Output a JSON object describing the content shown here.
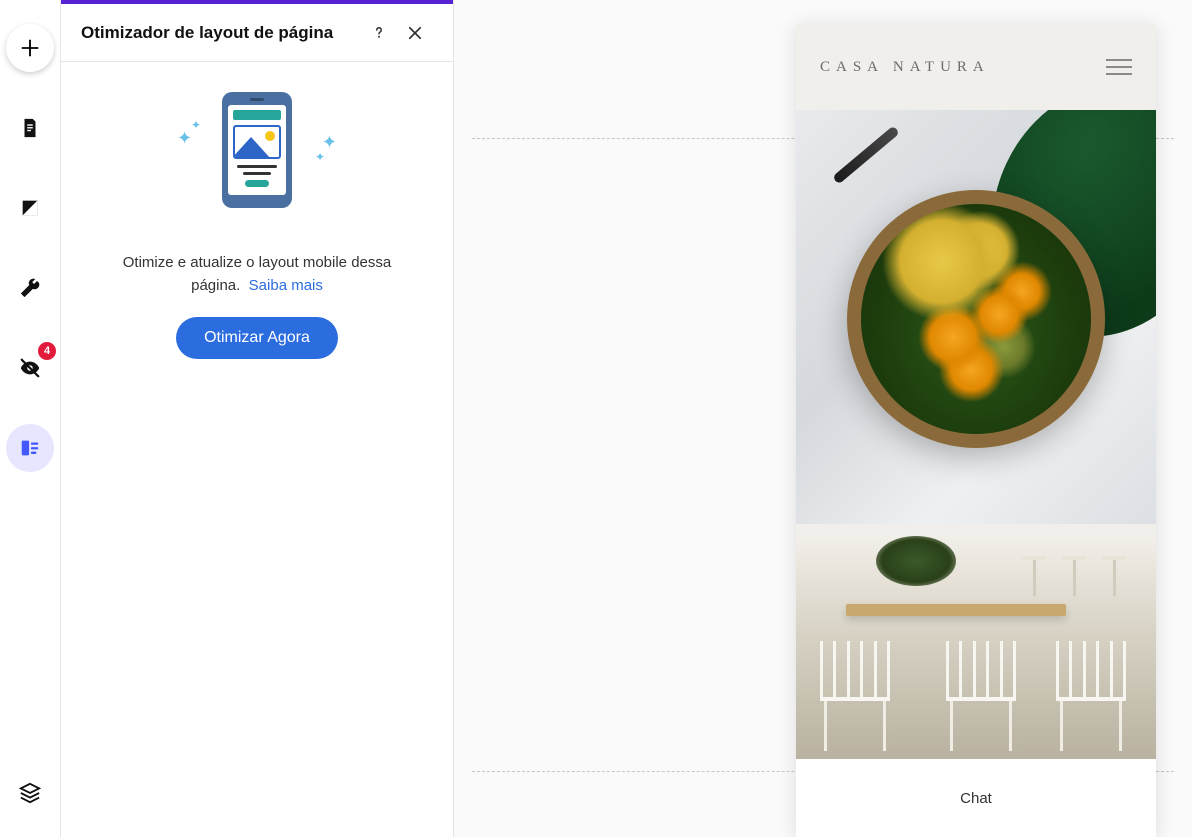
{
  "sidebar": {
    "badge_count": "4"
  },
  "panel": {
    "title": "Otimizador de layout de página",
    "description": "Otimize e atualize o layout mobile dessa página.",
    "learn_more": "Saiba mais",
    "cta": "Otimizar Agora"
  },
  "preview": {
    "site_title": "CASA NATURA",
    "chat_label": "Chat"
  }
}
